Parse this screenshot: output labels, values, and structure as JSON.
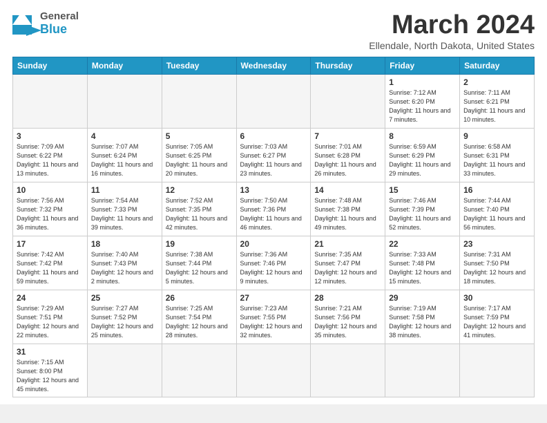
{
  "header": {
    "logo_general": "General",
    "logo_blue": "Blue",
    "title": "March 2024",
    "subtitle": "Ellendale, North Dakota, United States"
  },
  "days_of_week": [
    "Sunday",
    "Monday",
    "Tuesday",
    "Wednesday",
    "Thursday",
    "Friday",
    "Saturday"
  ],
  "weeks": [
    [
      {
        "num": "",
        "info": ""
      },
      {
        "num": "",
        "info": ""
      },
      {
        "num": "",
        "info": ""
      },
      {
        "num": "",
        "info": ""
      },
      {
        "num": "",
        "info": ""
      },
      {
        "num": "1",
        "info": "Sunrise: 7:12 AM\nSunset: 6:20 PM\nDaylight: 11 hours\nand 7 minutes."
      },
      {
        "num": "2",
        "info": "Sunrise: 7:11 AM\nSunset: 6:21 PM\nDaylight: 11 hours\nand 10 minutes."
      }
    ],
    [
      {
        "num": "3",
        "info": "Sunrise: 7:09 AM\nSunset: 6:22 PM\nDaylight: 11 hours\nand 13 minutes."
      },
      {
        "num": "4",
        "info": "Sunrise: 7:07 AM\nSunset: 6:24 PM\nDaylight: 11 hours\nand 16 minutes."
      },
      {
        "num": "5",
        "info": "Sunrise: 7:05 AM\nSunset: 6:25 PM\nDaylight: 11 hours\nand 20 minutes."
      },
      {
        "num": "6",
        "info": "Sunrise: 7:03 AM\nSunset: 6:27 PM\nDaylight: 11 hours\nand 23 minutes."
      },
      {
        "num": "7",
        "info": "Sunrise: 7:01 AM\nSunset: 6:28 PM\nDaylight: 11 hours\nand 26 minutes."
      },
      {
        "num": "8",
        "info": "Sunrise: 6:59 AM\nSunset: 6:29 PM\nDaylight: 11 hours\nand 29 minutes."
      },
      {
        "num": "9",
        "info": "Sunrise: 6:58 AM\nSunset: 6:31 PM\nDaylight: 11 hours\nand 33 minutes."
      }
    ],
    [
      {
        "num": "10",
        "info": "Sunrise: 7:56 AM\nSunset: 7:32 PM\nDaylight: 11 hours\nand 36 minutes."
      },
      {
        "num": "11",
        "info": "Sunrise: 7:54 AM\nSunset: 7:33 PM\nDaylight: 11 hours\nand 39 minutes."
      },
      {
        "num": "12",
        "info": "Sunrise: 7:52 AM\nSunset: 7:35 PM\nDaylight: 11 hours\nand 42 minutes."
      },
      {
        "num": "13",
        "info": "Sunrise: 7:50 AM\nSunset: 7:36 PM\nDaylight: 11 hours\nand 46 minutes."
      },
      {
        "num": "14",
        "info": "Sunrise: 7:48 AM\nSunset: 7:38 PM\nDaylight: 11 hours\nand 49 minutes."
      },
      {
        "num": "15",
        "info": "Sunrise: 7:46 AM\nSunset: 7:39 PM\nDaylight: 11 hours\nand 52 minutes."
      },
      {
        "num": "16",
        "info": "Sunrise: 7:44 AM\nSunset: 7:40 PM\nDaylight: 11 hours\nand 56 minutes."
      }
    ],
    [
      {
        "num": "17",
        "info": "Sunrise: 7:42 AM\nSunset: 7:42 PM\nDaylight: 11 hours\nand 59 minutes."
      },
      {
        "num": "18",
        "info": "Sunrise: 7:40 AM\nSunset: 7:43 PM\nDaylight: 12 hours\nand 2 minutes."
      },
      {
        "num": "19",
        "info": "Sunrise: 7:38 AM\nSunset: 7:44 PM\nDaylight: 12 hours\nand 5 minutes."
      },
      {
        "num": "20",
        "info": "Sunrise: 7:36 AM\nSunset: 7:46 PM\nDaylight: 12 hours\nand 9 minutes."
      },
      {
        "num": "21",
        "info": "Sunrise: 7:35 AM\nSunset: 7:47 PM\nDaylight: 12 hours\nand 12 minutes."
      },
      {
        "num": "22",
        "info": "Sunrise: 7:33 AM\nSunset: 7:48 PM\nDaylight: 12 hours\nand 15 minutes."
      },
      {
        "num": "23",
        "info": "Sunrise: 7:31 AM\nSunset: 7:50 PM\nDaylight: 12 hours\nand 18 minutes."
      }
    ],
    [
      {
        "num": "24",
        "info": "Sunrise: 7:29 AM\nSunset: 7:51 PM\nDaylight: 12 hours\nand 22 minutes."
      },
      {
        "num": "25",
        "info": "Sunrise: 7:27 AM\nSunset: 7:52 PM\nDaylight: 12 hours\nand 25 minutes."
      },
      {
        "num": "26",
        "info": "Sunrise: 7:25 AM\nSunset: 7:54 PM\nDaylight: 12 hours\nand 28 minutes."
      },
      {
        "num": "27",
        "info": "Sunrise: 7:23 AM\nSunset: 7:55 PM\nDaylight: 12 hours\nand 32 minutes."
      },
      {
        "num": "28",
        "info": "Sunrise: 7:21 AM\nSunset: 7:56 PM\nDaylight: 12 hours\nand 35 minutes."
      },
      {
        "num": "29",
        "info": "Sunrise: 7:19 AM\nSunset: 7:58 PM\nDaylight: 12 hours\nand 38 minutes."
      },
      {
        "num": "30",
        "info": "Sunrise: 7:17 AM\nSunset: 7:59 PM\nDaylight: 12 hours\nand 41 minutes."
      }
    ],
    [
      {
        "num": "31",
        "info": "Sunrise: 7:15 AM\nSunset: 8:00 PM\nDaylight: 12 hours\nand 45 minutes."
      },
      {
        "num": "",
        "info": ""
      },
      {
        "num": "",
        "info": ""
      },
      {
        "num": "",
        "info": ""
      },
      {
        "num": "",
        "info": ""
      },
      {
        "num": "",
        "info": ""
      },
      {
        "num": "",
        "info": ""
      }
    ]
  ]
}
